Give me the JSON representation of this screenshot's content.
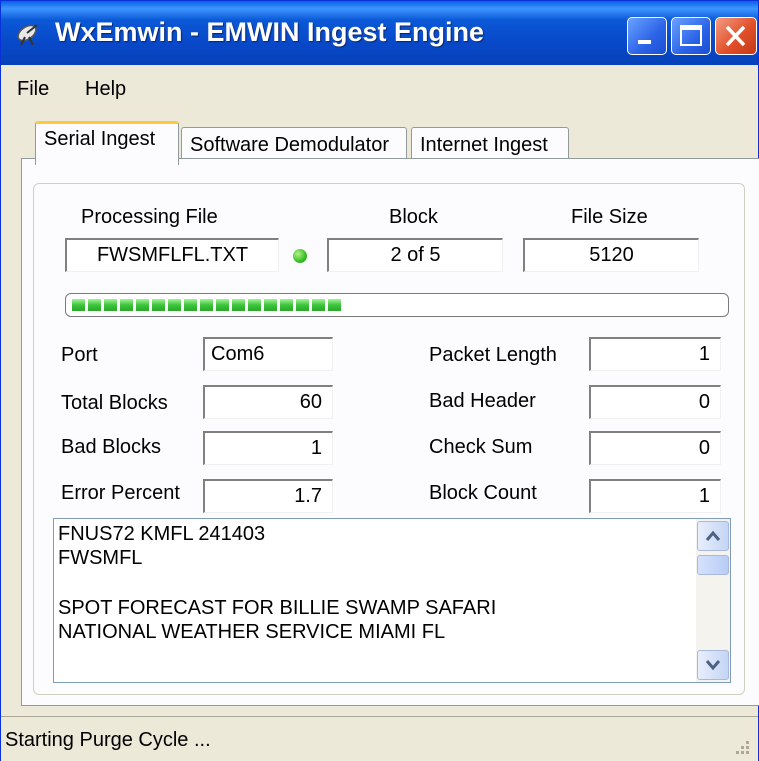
{
  "window": {
    "title": "WxEmwin - EMWIN Ingest Engine",
    "app_icon": "satellite-dish-icon"
  },
  "menu": {
    "items": [
      {
        "label": "File"
      },
      {
        "label": "Help"
      }
    ]
  },
  "tabs": [
    {
      "label": "Serial Ingest",
      "active": true
    },
    {
      "label": "Software Demodulator",
      "active": false
    },
    {
      "label": "Internet Ingest",
      "active": false
    }
  ],
  "header": {
    "processing_file_label": "Processing File",
    "block_label": "Block",
    "file_size_label": "File Size",
    "processing_file_value": "FWSMFLFL.TXT",
    "block_value": "2 of 5",
    "file_size_value": "5120",
    "status_led_color": "#3ec42a"
  },
  "progress": {
    "fraction": 0.42,
    "color": "#3cc63c"
  },
  "stats": {
    "port_label": "Port",
    "port_value": "Com6",
    "total_blocks_label": "Total Blocks",
    "total_blocks_value": "60",
    "bad_blocks_label": "Bad Blocks",
    "bad_blocks_value": "1",
    "error_percent_label": "Error Percent",
    "error_percent_value": "1.7",
    "packet_length_label": "Packet Length",
    "packet_length_value": "1",
    "bad_header_label": "Bad Header",
    "bad_header_value": "0",
    "check_sum_label": "Check Sum",
    "check_sum_value": "0",
    "block_count_label": "Block Count",
    "block_count_value": "1"
  },
  "text_area": {
    "lines": [
      "FNUS72 KMFL 241403",
      "FWSMFL",
      "",
      "SPOT FORECAST FOR BILLIE SWAMP SAFARI",
      "NATIONAL WEATHER SERVICE MIAMI FL"
    ]
  },
  "statusbar": {
    "text": "Starting Purge Cycle ..."
  }
}
